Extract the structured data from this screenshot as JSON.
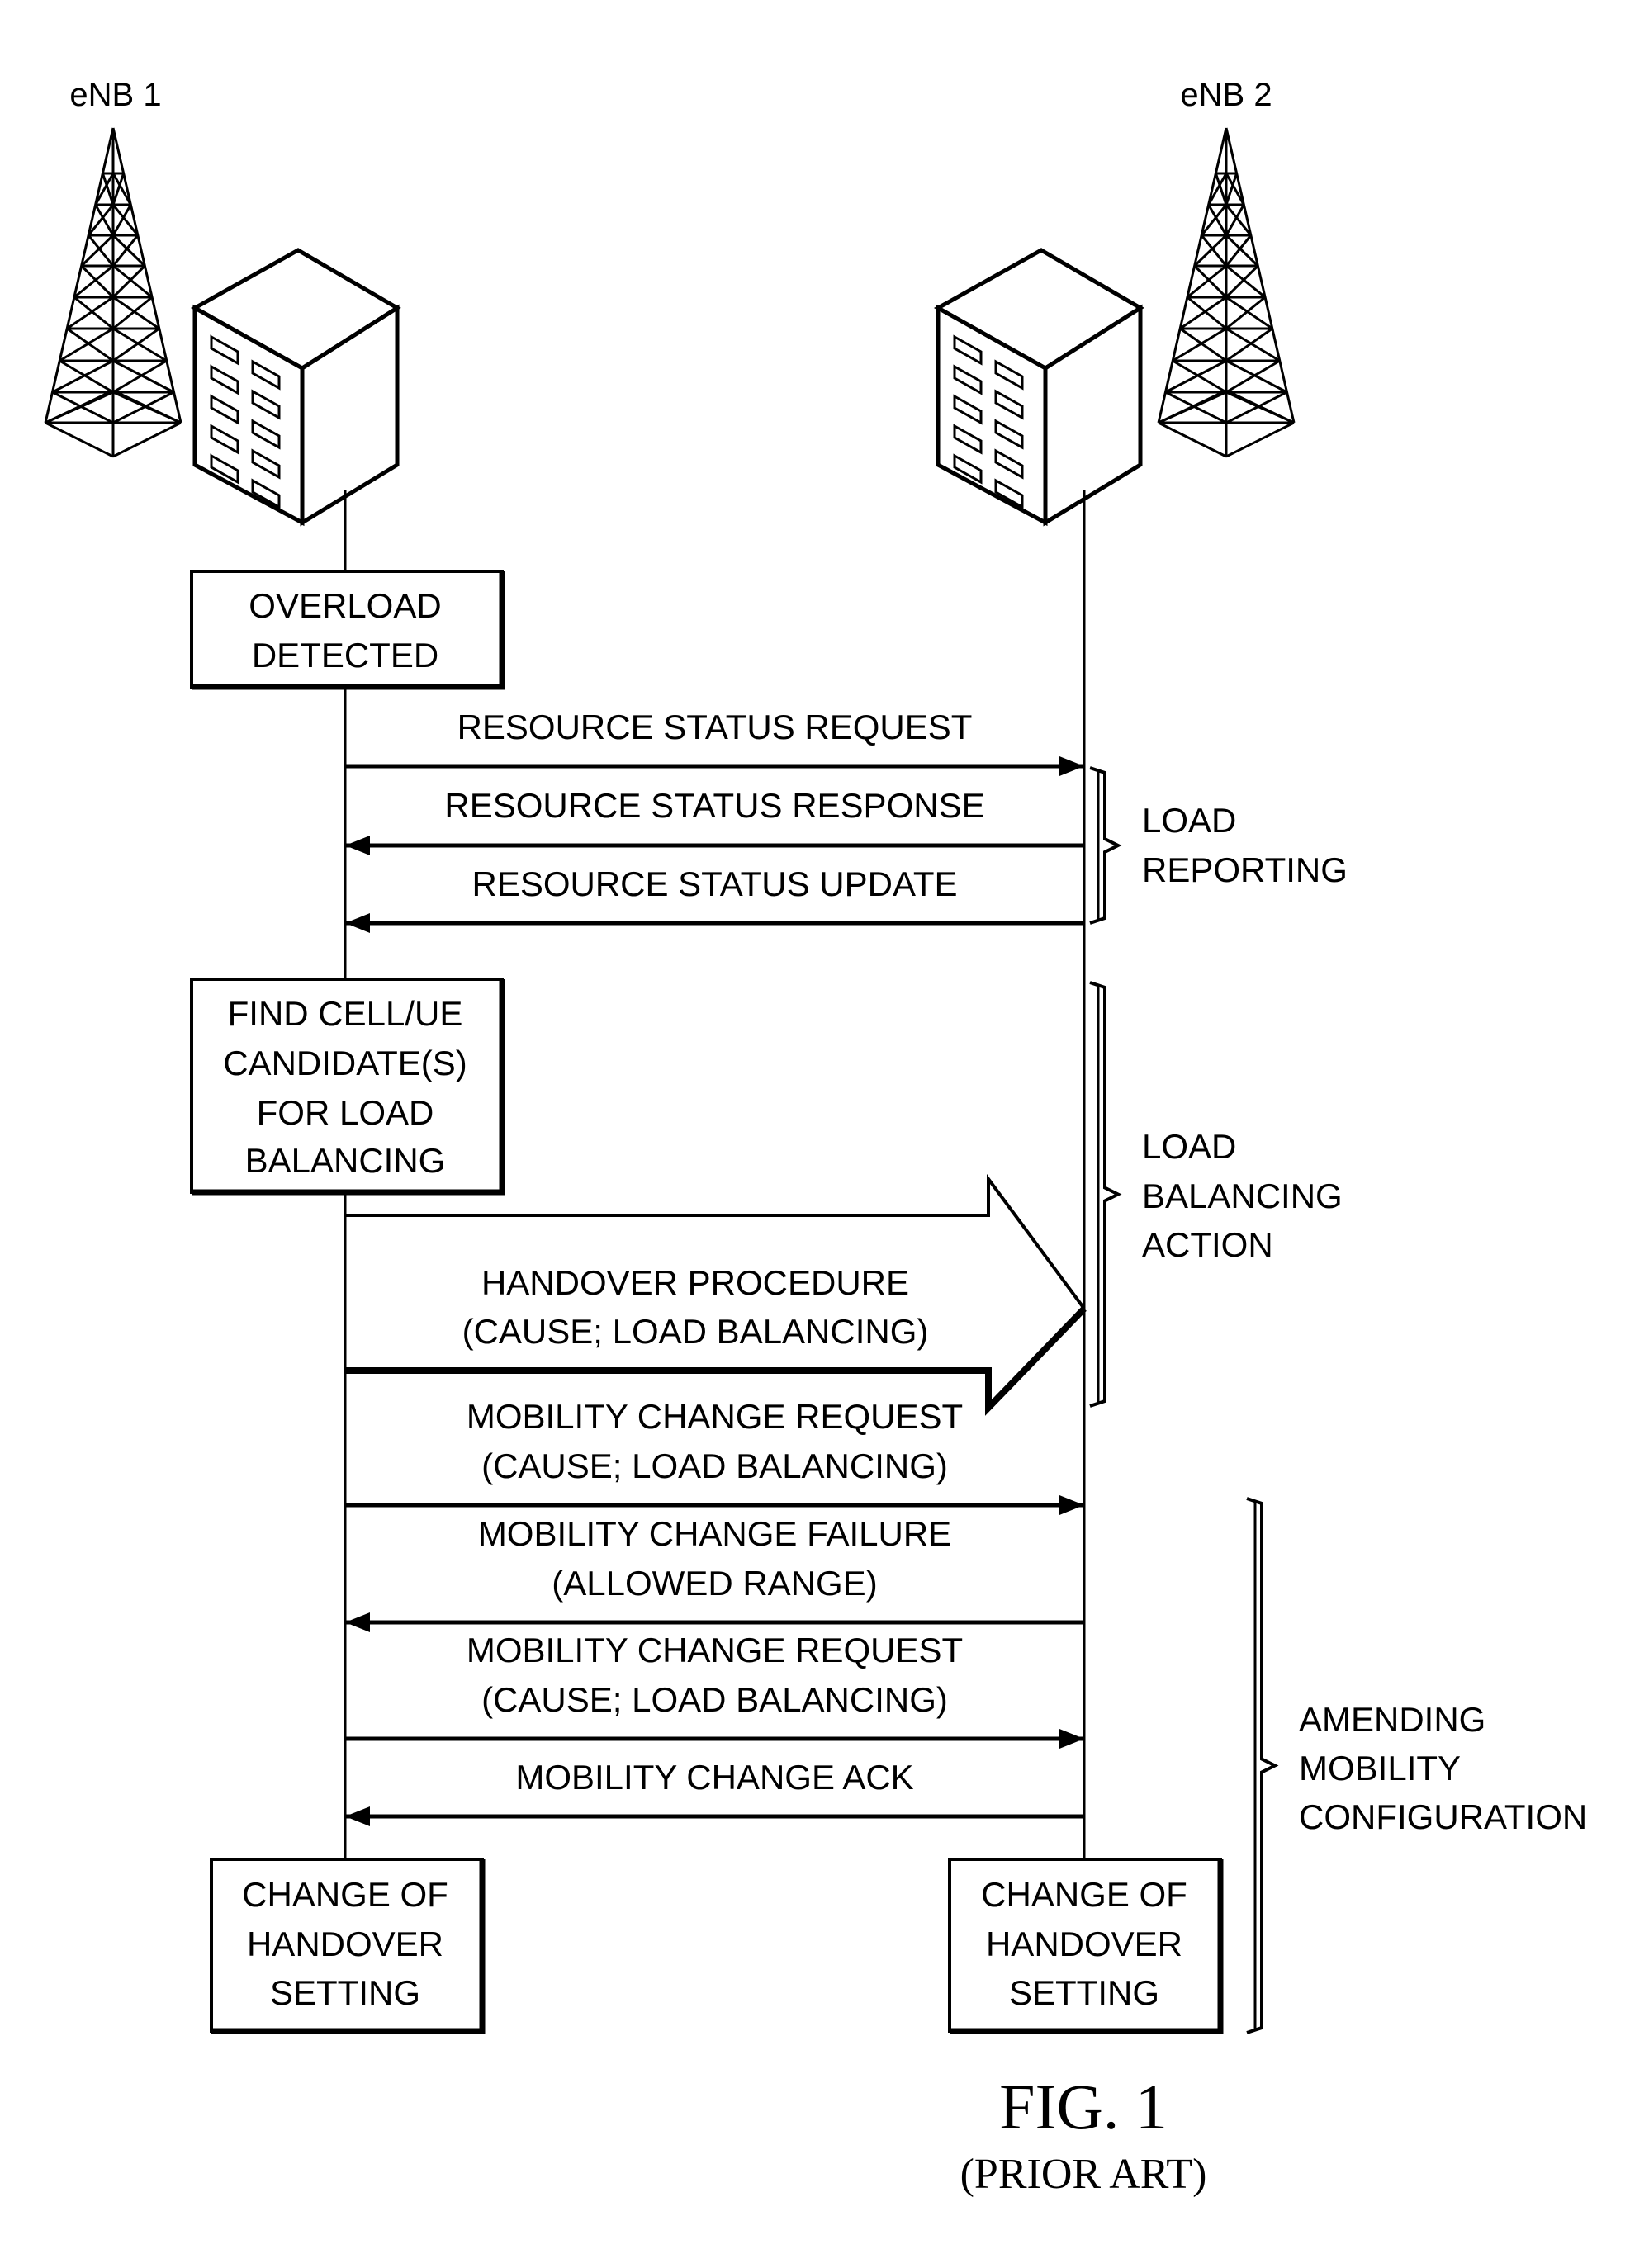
{
  "figure": {
    "title": "FIG. 1",
    "subtitle": "(PRIOR ART)"
  },
  "nodes": [
    {
      "id": "enb1",
      "label": "eNB 1",
      "icons": [
        "cell-tower-icon",
        "building-icon"
      ]
    },
    {
      "id": "enb2",
      "label": "eNB 2",
      "icons": [
        "building-icon",
        "cell-tower-icon"
      ]
    }
  ],
  "process_boxes": {
    "overload": {
      "node": "enb1",
      "lines": [
        "OVERLOAD",
        "DETECTED"
      ]
    },
    "find_candidates": {
      "node": "enb1",
      "lines": [
        "FIND CELL/UE",
        "CANDIDATE(S)",
        "FOR LOAD",
        "BALANCING"
      ]
    },
    "change_left": {
      "node": "enb1",
      "lines": [
        "CHANGE OF",
        "HANDOVER",
        "SETTING"
      ]
    },
    "change_right": {
      "node": "enb2",
      "lines": [
        "CHANGE OF",
        "HANDOVER",
        "SETTING"
      ]
    }
  },
  "messages": [
    {
      "from": "enb1",
      "to": "enb2",
      "lines": [
        "RESOURCE STATUS REQUEST"
      ]
    },
    {
      "from": "enb2",
      "to": "enb1",
      "lines": [
        "RESOURCE STATUS RESPONSE"
      ]
    },
    {
      "from": "enb2",
      "to": "enb1",
      "lines": [
        "RESOURCE STATUS UPDATE"
      ]
    },
    {
      "from": "enb1",
      "to": "enb2",
      "style": "block-arrow",
      "lines": [
        "HANDOVER PROCEDURE",
        "(CAUSE; LOAD BALANCING)"
      ]
    },
    {
      "from": "enb1",
      "to": "enb2",
      "lines": [
        "MOBILITY CHANGE REQUEST",
        "(CAUSE; LOAD BALANCING)"
      ]
    },
    {
      "from": "enb2",
      "to": "enb1",
      "lines": [
        "MOBILITY CHANGE FAILURE",
        "(ALLOWED RANGE)"
      ]
    },
    {
      "from": "enb1",
      "to": "enb2",
      "lines": [
        "MOBILITY CHANGE REQUEST",
        "(CAUSE; LOAD BALANCING)"
      ]
    },
    {
      "from": "enb2",
      "to": "enb1",
      "lines": [
        "MOBILITY CHANGE ACK"
      ]
    }
  ],
  "groups": [
    {
      "lines": [
        "LOAD",
        "REPORTING"
      ]
    },
    {
      "lines": [
        "LOAD",
        "BALANCING",
        "ACTION"
      ]
    },
    {
      "lines": [
        "AMENDING",
        "MOBILITY",
        "CONFIGURATION"
      ]
    }
  ]
}
